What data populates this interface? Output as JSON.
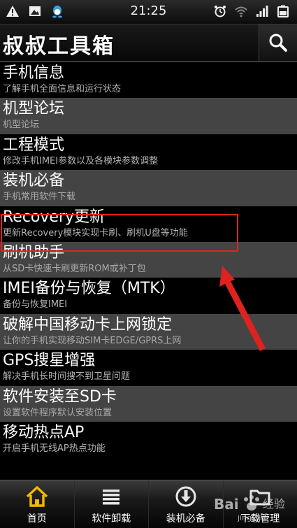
{
  "status_bar": {
    "time": "21:25",
    "left_icons": [
      "warning-icon",
      "image-icon",
      "qq-icon"
    ],
    "right_icons": [
      "alarm-icon",
      "wifi-icon",
      "signal-icon",
      "battery-icon"
    ]
  },
  "header": {
    "title": "叔叔工具箱",
    "search_icon": "search-icon"
  },
  "menu": {
    "items": [
      {
        "title": "手机信息",
        "subtitle": "了解手机全面信息和运行状态"
      },
      {
        "title": "机型论坛",
        "subtitle": "机型论坛"
      },
      {
        "title": "工程模式",
        "subtitle": "修改手机IMEI参数以及各模块参数调整"
      },
      {
        "title": "装机必备",
        "subtitle": "手机常用软件下载"
      },
      {
        "title": "Recovery更新",
        "subtitle": "更新Recovery模块实现卡刷、刷机U盘等功能"
      },
      {
        "title": "刷机助手",
        "subtitle": "从SD卡快速卡刷更新ROM或补丁包"
      },
      {
        "title": "IMEI备份与恢复（MTK）",
        "subtitle": "备份与恢复IMEI"
      },
      {
        "title": "破解中国移动卡上网锁定",
        "subtitle": "让你的手机实现移动SIM卡EDGE/GPRS上网"
      },
      {
        "title": "GPS搜星增强",
        "subtitle": "解决手机长时间搜不到卫星问题"
      },
      {
        "title": "软件安装至SD卡",
        "subtitle": "设置软件程序默认安装位置"
      },
      {
        "title": "移动热点AP",
        "subtitle": "开启手机无线AP热点功能"
      }
    ]
  },
  "bottom_nav": {
    "items": [
      {
        "label": "首页",
        "icon": "home-icon"
      },
      {
        "label": "软件卸载",
        "icon": "list-icon"
      },
      {
        "label": "装机必备",
        "icon": "download-icon"
      },
      {
        "label": "下载管理",
        "icon": "folder-icon"
      }
    ]
  },
  "colors": {
    "accent_yellow": "#f2b800",
    "highlight_red": "#e0221f",
    "row_light": "#444444",
    "row_dark": "#000000"
  },
  "watermark": {
    "text": "Bai",
    "text2": "经验",
    "text3": "jingyan"
  }
}
